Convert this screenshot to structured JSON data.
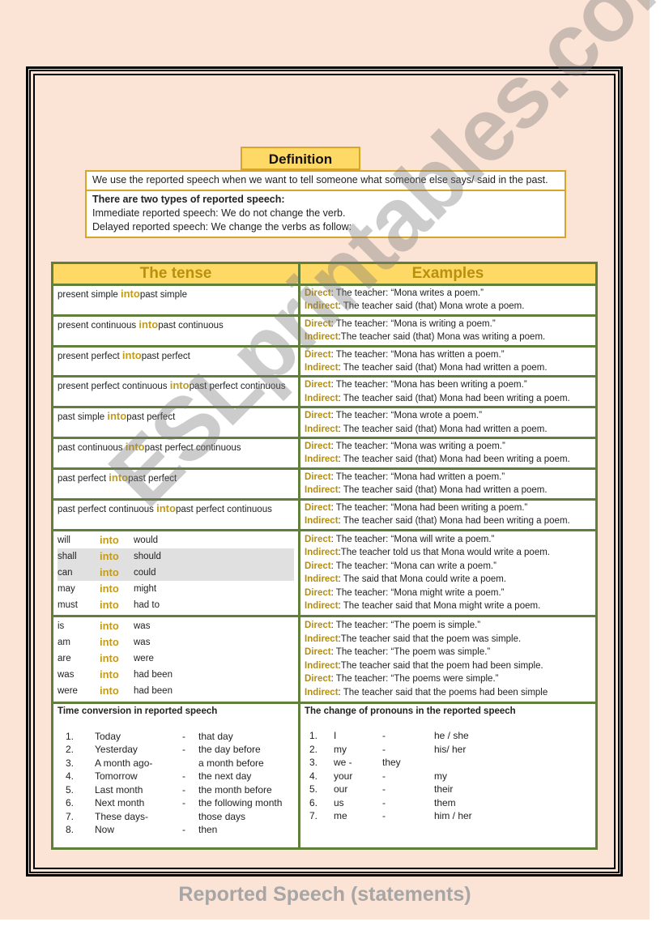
{
  "definition": {
    "title": "Definition",
    "text": "We use the reported speech when we want to tell someone what someone else says/ said in the past.",
    "types_heading": "There are two types of reported speech:",
    "immediate": "Immediate reported speech: We do not change the verb.",
    "delayed": "Delayed reported speech: We change the verbs as follow:"
  },
  "table": {
    "headers": {
      "tense": "The tense",
      "examples": "Examples"
    },
    "into_word": "into",
    "direct_label": "Direct",
    "indirect_label": "Indirect",
    "rows": [
      {
        "from": "present simple",
        "to": "past simple",
        "direct": ":    The teacher: “Mona writes a poem.”",
        "indirect": ": The teacher said (that) Mona wrote a poem."
      },
      {
        "from": "present continuous",
        "to": "past continuous",
        "direct": ":    The teacher: “Mona is writing a poem.”",
        "indirect": ":The teacher said (that) Mona was writing a poem."
      },
      {
        "from": "present perfect",
        "to": "past perfect",
        "direct": ":    The teacher: “Mona has written a poem.”",
        "indirect": ": The teacher said (that) Mona had written a poem."
      },
      {
        "from": "present perfect continuous",
        "to": "past perfect continuous",
        "direct": ":    The teacher: “Mona has been writing a poem.”",
        "indirect": ": The teacher said (that) Mona had been writing a poem."
      },
      {
        "from": "past simple",
        "to": "past perfect",
        "direct": ":    The teacher: “Mona wrote a poem.”",
        "indirect": ": The teacher said (that) Mona had written a poem."
      },
      {
        "from": "past continuous",
        "to": "past perfect continuous",
        "direct": ":    The teacher: “Mona was writing a poem.”",
        "indirect": ": The teacher said (that) Mona had been writing a poem."
      },
      {
        "from": "past  perfect",
        "to": "past perfect",
        "direct": ":    The teacher: “Mona had written a poem.”",
        "indirect": ": The teacher said (that) Mona had written a poem."
      },
      {
        "from": "past  perfect  continuous",
        "to": "past perfect continuous",
        "direct": ":    The teacher: “Mona had been writing a poem.”",
        "indirect": ": The teacher said (that) Mona had been writing a poem."
      }
    ],
    "modals": [
      {
        "from": "will",
        "to": "would"
      },
      {
        "from": "shall",
        "to": "should"
      },
      {
        "from": "can",
        "to": "could"
      },
      {
        "from": "may",
        "to": "might"
      },
      {
        "from": "must",
        "to": "had to"
      }
    ],
    "modal_examples": [
      {
        "label": "Direct",
        "text": ":    The teacher: “Mona will write a poem.”"
      },
      {
        "label": "Indirect",
        "text": ":The teacher told us that Mona would write a poem."
      },
      {
        "label": "Direct",
        "text": ":    The teacher: “Mona can write a poem.”"
      },
      {
        "label": "Indirect",
        "text": ": The said that Mona could write a poem."
      },
      {
        "label": "Direct",
        "text": ":    The teacher: “Mona might write a poem.”"
      },
      {
        "label": "Indirect",
        "text": ": The teacher said that Mona might write a poem."
      }
    ],
    "be_verbs": [
      {
        "from": "is",
        "to": "was"
      },
      {
        "from": "am",
        "to": "was"
      },
      {
        "from": "are",
        "to": "were"
      },
      {
        "from": "was",
        "to": "had been"
      },
      {
        "from": "were",
        "to": "had been"
      }
    ],
    "be_examples": [
      {
        "label": "Direct",
        "text": ":  The teacher: “The poem is simple.”"
      },
      {
        "label": "Indirect",
        "text": ":The teacher said that the poem was simple."
      },
      {
        "label": "Direct",
        "text": ": The teacher: “The poem was simple.”"
      },
      {
        "label": "Indirect",
        "text": ":The teacher said that the poem had been simple."
      },
      {
        "label": "Direct",
        "text": ":    The teacher: “The poems were simple.”"
      },
      {
        "label": "Indirect",
        "text": ":  The teacher said that the poems had been simple"
      }
    ],
    "time_conversion": {
      "title": "Time conversion in reported speech",
      "items": [
        {
          "num": "1.",
          "from": "Today",
          "dash": "-",
          "to": "that day"
        },
        {
          "num": "2.",
          "from": "Yesterday",
          "dash": "-",
          "to": "the day before"
        },
        {
          "num": "3.",
          "from": "A month ago-",
          "dash": "",
          "to": "a month before"
        },
        {
          "num": "4.",
          "from": "Tomorrow",
          "dash": "-",
          "to": "the next day"
        },
        {
          "num": "5.",
          "from": "Last month",
          "dash": "-",
          "to": "the month before"
        },
        {
          "num": "6.",
          "from": "Next month",
          "dash": "-",
          "to": "the following month"
        },
        {
          "num": "7.",
          "from": "These days-",
          "dash": "",
          "to": "those days"
        },
        {
          "num": "8.",
          "from": "Now",
          "dash": "-",
          "to": "then"
        }
      ]
    },
    "pronouns": {
      "title": "The change of pronouns in the reported speech",
      "items": [
        {
          "num": "1.",
          "from": "I",
          "dash": "-",
          "to": "he / she"
        },
        {
          "num": "2.",
          "from": "my",
          "dash": "-",
          "to": "his/ her"
        },
        {
          "num": "3.",
          "from": "we -",
          "dash": "they",
          "to": ""
        },
        {
          "num": "4.",
          "from": "your",
          "dash": "-",
          "to": "my"
        },
        {
          "num": "5.",
          "from": "our",
          "dash": "-",
          "to": "their"
        },
        {
          "num": "6.",
          "from": "us",
          "dash": "-",
          "to": "them"
        },
        {
          "num": "7.",
          "from": "me",
          "dash": "-",
          "to": "him / her"
        }
      ]
    }
  },
  "watermark": "ESLprintables.com",
  "footer": "Reported Speech (statements)"
}
